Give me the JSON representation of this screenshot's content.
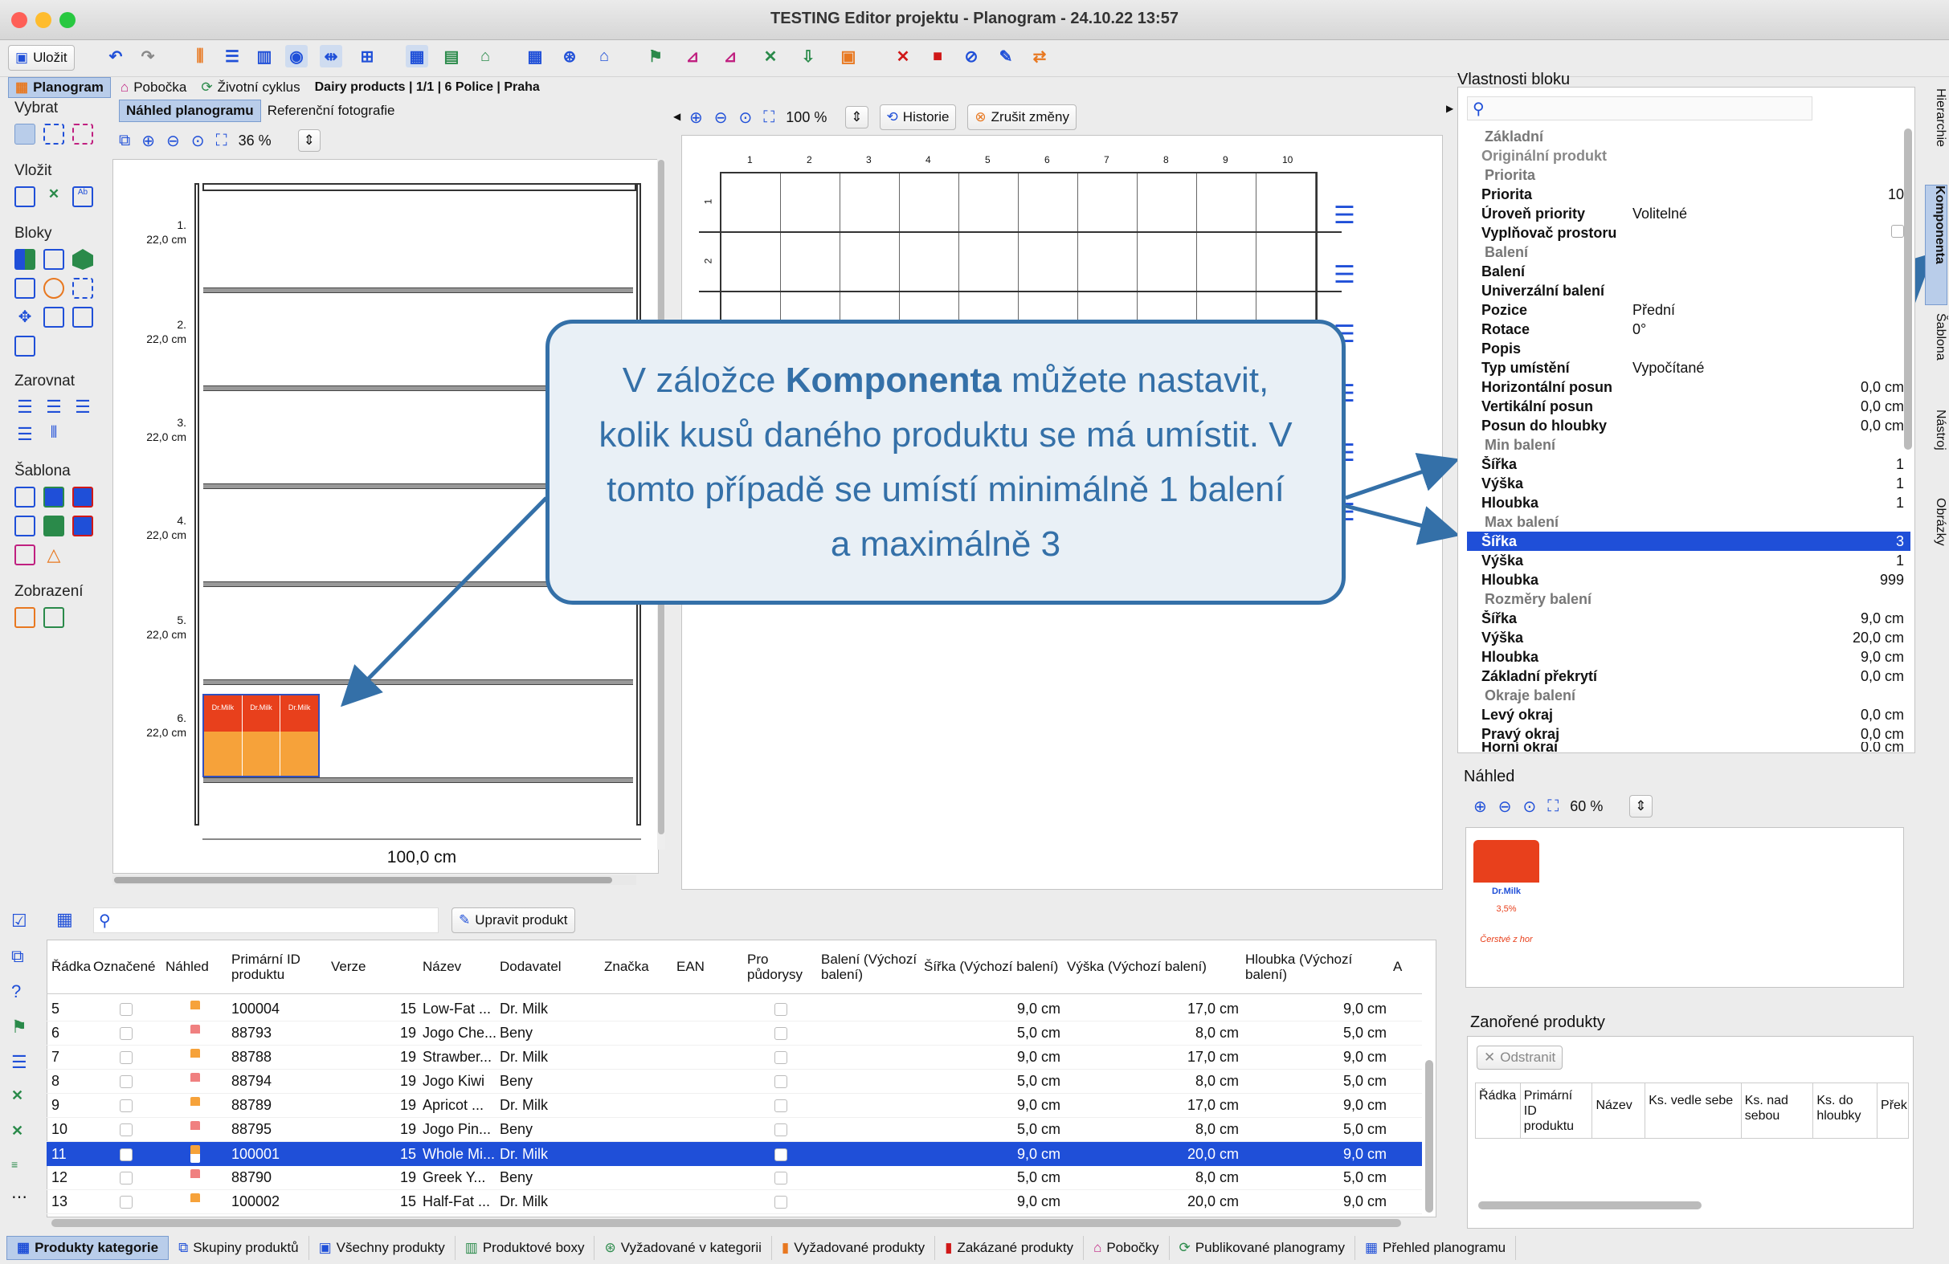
{
  "window": {
    "title": "TESTING Editor projektu - Planogram - 24.10.22 13:57"
  },
  "toolbar": {
    "save": "Uložit"
  },
  "context_bar": {
    "tab_planogram": "Planogram",
    "tab_branch": "Pobočka",
    "tab_lifecycle": "Životní cyklus",
    "breadcrumb": "Dairy products | 1/1 | 6 Police | Praha"
  },
  "left_tools": {
    "select": "Vybrat",
    "insert": "Vložit",
    "blocks": "Bloky",
    "align": "Zarovnat",
    "template": "Šablona",
    "display": "Zobrazení"
  },
  "preview_tabs": {
    "planogram_preview": "Náhled planogramu",
    "reference_photo": "Referenční fotografie",
    "zoom": "36 %"
  },
  "shelves": [
    {
      "label": "1.",
      "size": "22,0 cm"
    },
    {
      "label": "2.",
      "size": "22,0 cm"
    },
    {
      "label": "3.",
      "size": "22,0 cm"
    },
    {
      "label": "4.",
      "size": "22,0 cm"
    },
    {
      "label": "5.",
      "size": "22,0 cm"
    },
    {
      "label": "6.",
      "size": "22,0 cm"
    }
  ],
  "shelf_width": "100,0 cm",
  "product_brand": "Dr.Milk",
  "grid_view": {
    "zoom": "100 %",
    "history": "Historie",
    "discard": "Zrušit změny",
    "columns": [
      "1",
      "2",
      "3",
      "4",
      "5",
      "6",
      "7",
      "8",
      "9",
      "10"
    ],
    "rows": [
      "1",
      "2"
    ]
  },
  "callout": {
    "part1": "V záložce ",
    "bold": "Komponenta",
    "part2": " můžete nastavit, kolik kusů daného produktu se má umístit. V tomto případě se umístí minimálně 1 balení a maximálně 3"
  },
  "properties": {
    "title": "Vlastnosti bloku",
    "basic": "Základní",
    "original_product": "Originální produkt",
    "priority_sec": "Priorita",
    "priority": "Priorita",
    "priority_val": "10",
    "priority_level": "Úroveň priority",
    "priority_level_val": "Volitelné",
    "space_filler": "Vyplňovač prostoru",
    "packaging_sec": "Balení",
    "packaging": "Balení",
    "universal": "Univerzální balení",
    "position": "Pozice",
    "position_val": "Přední",
    "rotation": "Rotace",
    "rotation_val": "0°",
    "label": "Popis",
    "placement_type": "Typ umístění",
    "placement_type_val": "Vypočítané",
    "h_offset": "Horizontální posun",
    "h_offset_val": "0,0 cm",
    "v_offset": "Vertikální posun",
    "v_offset_val": "0,0 cm",
    "depth_offset": "Posun do hloubky",
    "depth_offset_val": "0,0 cm",
    "min_sec": "Min balení",
    "min_w": "Šířka",
    "min_w_val": "1",
    "min_h": "Výška",
    "min_h_val": "1",
    "min_d": "Hloubka",
    "min_d_val": "1",
    "max_sec": "Max balení",
    "max_w": "Šířka",
    "max_w_val": "3",
    "max_h": "Výška",
    "max_h_val": "1",
    "max_d": "Hloubka",
    "max_d_val": "999",
    "dims_sec": "Rozměry balení",
    "dim_w": "Šířka",
    "dim_w_val": "9,0 cm",
    "dim_h": "Výška",
    "dim_h_val": "20,0 cm",
    "dim_d": "Hloubka",
    "dim_d_val": "9,0 cm",
    "overlap": "Základní překrytí",
    "overlap_val": "0,0 cm",
    "edges_sec": "Okraje balení",
    "left_edge": "Levý okraj",
    "left_edge_val": "0,0 cm",
    "right_edge": "Pravý okraj",
    "right_edge_val": "0,0 cm",
    "top_edge": "Horní okraj",
    "top_edge_val": "0,0 cm"
  },
  "side_tabs": [
    "Hierarchie",
    "Komponenta",
    "Šablona",
    "Nástroj",
    "Obrázky"
  ],
  "preview_panel": {
    "title": "Náhled",
    "zoom": "60 %",
    "brand": "Dr.Milk",
    "fat": "3,5%",
    "slogan": "Čerstvé z hor"
  },
  "nested": {
    "title": "Zanořené produkty",
    "remove": "Odstranit",
    "cols": [
      "Řádka",
      "Primární ID produktu",
      "Název",
      "Ks. vedle sebe",
      "Ks. nad sebou",
      "Ks. do hloubky",
      "Přek"
    ]
  },
  "table": {
    "edit_button": "Upravit produkt",
    "headers": [
      "Řádka",
      "Označené",
      "Náhled",
      "Primární ID produktu",
      "Verze",
      "Název",
      "Dodavatel",
      "Značka",
      "EAN",
      "Pro půdorysy",
      "Balení (Výchozí balení)",
      "Šířka (Výchozí balení)",
      "Výška (Výchozí balení)",
      "Hloubka (Výchozí balení)",
      "A"
    ],
    "rows": [
      {
        "n": "5",
        "id": "100004",
        "ver": "15",
        "name": "Low-Fat ...",
        "sup": "Dr. Milk",
        "w": "9,0 cm",
        "h": "17,0 cm",
        "d": "9,0 cm"
      },
      {
        "n": "6",
        "id": "88793",
        "ver": "19",
        "name": "Jogo Che...",
        "sup": "Beny",
        "w": "5,0 cm",
        "h": "8,0 cm",
        "d": "5,0 cm"
      },
      {
        "n": "7",
        "id": "88788",
        "ver": "19",
        "name": "Strawber...",
        "sup": "Dr. Milk",
        "w": "9,0 cm",
        "h": "17,0 cm",
        "d": "9,0 cm"
      },
      {
        "n": "8",
        "id": "88794",
        "ver": "19",
        "name": "Jogo Kiwi",
        "sup": "Beny",
        "w": "5,0 cm",
        "h": "8,0 cm",
        "d": "5,0 cm"
      },
      {
        "n": "9",
        "id": "88789",
        "ver": "19",
        "name": "Apricot ...",
        "sup": "Dr. Milk",
        "w": "9,0 cm",
        "h": "17,0 cm",
        "d": "9,0 cm"
      },
      {
        "n": "10",
        "id": "88795",
        "ver": "19",
        "name": "Jogo Pin...",
        "sup": "Beny",
        "w": "5,0 cm",
        "h": "8,0 cm",
        "d": "5,0 cm"
      },
      {
        "n": "11",
        "id": "100001",
        "ver": "15",
        "name": "Whole Mi...",
        "sup": "Dr. Milk",
        "w": "9,0 cm",
        "h": "20,0 cm",
        "d": "9,0 cm"
      },
      {
        "n": "12",
        "id": "88790",
        "ver": "19",
        "name": "Greek Y...",
        "sup": "Beny",
        "w": "5,0 cm",
        "h": "8,0 cm",
        "d": "5,0 cm"
      },
      {
        "n": "13",
        "id": "100002",
        "ver": "15",
        "name": "Half-Fat ...",
        "sup": "Dr. Milk",
        "w": "9,0 cm",
        "h": "20,0 cm",
        "d": "9,0 cm"
      }
    ]
  },
  "bottom_tabs": [
    "Produkty kategorie",
    "Skupiny produktů",
    "Všechny produkty",
    "Produktové boxy",
    "Vyžadované v kategorii",
    "Vyžadované produkty",
    "Zakázané produkty",
    "Pobočky",
    "Publikované planogramy",
    "Přehled planogramu"
  ],
  "colors": {
    "accent": "#1f4fd8",
    "callout": "#3470a8"
  }
}
